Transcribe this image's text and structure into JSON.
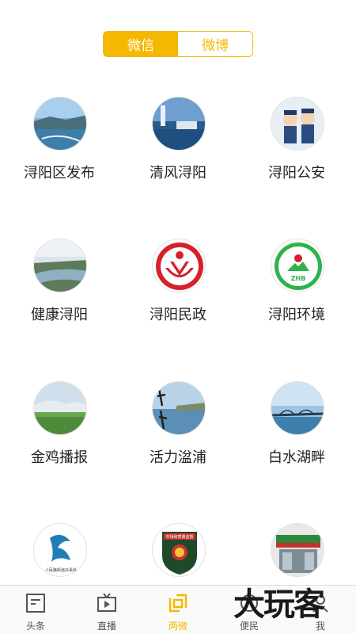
{
  "toggle": {
    "wechat": "微信",
    "weibo": "微博",
    "active": "wechat"
  },
  "accounts": [
    {
      "label": "浔阳区发布",
      "icon": "city-lake-photo-icon"
    },
    {
      "label": "清风浔阳",
      "icon": "lakeside-pavilion-photo-icon"
    },
    {
      "label": "浔阳公安",
      "icon": "police-cartoon-icon"
    },
    {
      "label": "健康浔阳",
      "icon": "aerial-river-photo-icon"
    },
    {
      "label": "浔阳民政",
      "icon": "civil-affairs-emblem-icon"
    },
    {
      "label": "浔阳环境",
      "icon": "zhb-environment-emblem-icon"
    },
    {
      "label": "金鸡播报",
      "icon": "green-hills-photo-icon"
    },
    {
      "label": "活力湓浦",
      "icon": "calligraphy-river-photo-icon"
    },
    {
      "label": "白水湖畔",
      "icon": "bridge-photo-icon"
    },
    {
      "label": "",
      "icon": "street-office-logo-icon"
    },
    {
      "label": "",
      "icon": "market-supervision-badge-icon"
    },
    {
      "label": "",
      "icon": "storefront-photo-icon"
    }
  ],
  "avatar_text": {
    "zhb": "ZHB",
    "street_office": "人民路街道办事处",
    "market_badge": "市场和质量监督"
  },
  "tabs": [
    {
      "label": "头条",
      "icon": "headline-icon"
    },
    {
      "label": "直播",
      "icon": "tv-live-icon"
    },
    {
      "label": "两微",
      "icon": "two-micro-icon"
    },
    {
      "label": "便民",
      "icon": "service-icon"
    },
    {
      "label": "我",
      "icon": "profile-icon"
    }
  ],
  "active_tab": 2,
  "watermark": "大玩客",
  "colors": {
    "accent": "#f5b800",
    "text": "#222222",
    "tab_text": "#555555"
  }
}
